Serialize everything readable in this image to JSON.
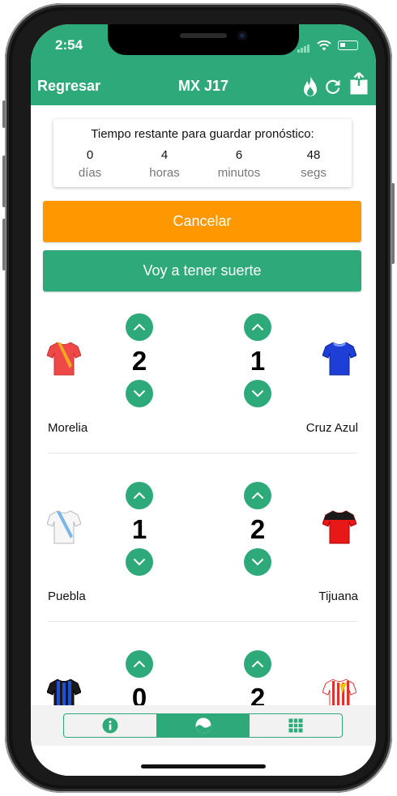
{
  "status_bar": {
    "time": "2:54"
  },
  "nav": {
    "back_label": "Regresar",
    "title": "MX J17"
  },
  "countdown": {
    "heading": "Tiempo restante para guardar pronóstico:",
    "units": [
      {
        "value": "0",
        "label": "días"
      },
      {
        "value": "4",
        "label": "horas"
      },
      {
        "value": "6",
        "label": "minutos"
      },
      {
        "value": "48",
        "label": "segs"
      }
    ]
  },
  "buttons": {
    "cancel_label": "Cancelar",
    "lucky_label": "Voy a tener suerte"
  },
  "matches": [
    {
      "home": {
        "name": "Morelia",
        "score": "2"
      },
      "away": {
        "name": "Cruz Azul",
        "score": "1"
      }
    },
    {
      "home": {
        "name": "Puebla",
        "score": "1"
      },
      "away": {
        "name": "Tijuana",
        "score": "2"
      }
    },
    {
      "home": {
        "name": "",
        "score": "0"
      },
      "away": {
        "name": "",
        "score": "2"
      }
    }
  ],
  "tabs": [
    {
      "icon": "info-icon",
      "active": false
    },
    {
      "icon": "ball-icon",
      "active": true
    },
    {
      "icon": "grid-icon",
      "active": false
    }
  ],
  "colors": {
    "primary": "#2eaa7a",
    "cancel": "#ff9800"
  }
}
